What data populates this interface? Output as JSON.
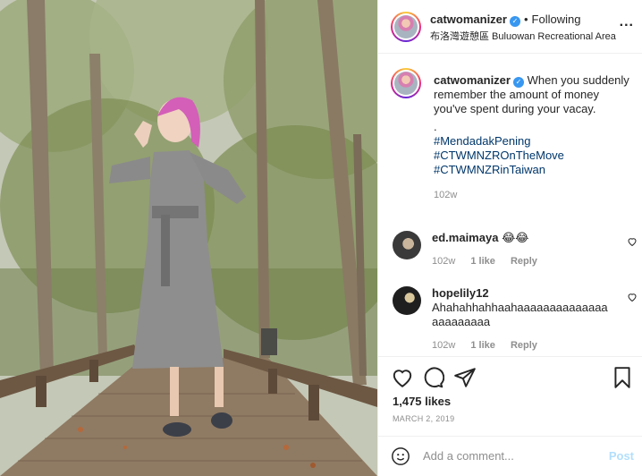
{
  "post": {
    "author": "catwomanizer",
    "verified": true,
    "follow_status": "Following",
    "location": "布洛灣遊憩區 Buluowan Recreational Area",
    "more_label": "...",
    "caption": "When you suddenly remember the amount of money you've spent during your vacay.",
    "caption_dot": ".",
    "hashtags": [
      "#MendadakPening",
      "#CTWMNZROnTheMove",
      "#CTWMNZRinTaiwan"
    ],
    "caption_age": "102w",
    "likes": "1,475 likes",
    "date": "MARCH 2, 2019"
  },
  "comments": [
    {
      "user": "ed.maimaya",
      "text": "😂😂",
      "age": "102w",
      "likes": "1 like",
      "reply_label": "Reply"
    },
    {
      "user": "hopelily12",
      "text": "Ahahahhahhaahaaaaaaaaaaaaaaaaaaaaaaa",
      "age": "102w",
      "likes": "1 like",
      "reply_label": "Reply"
    }
  ],
  "add_comment": {
    "placeholder": "Add a comment...",
    "post_label": "Post"
  },
  "icons": {
    "like": "heart-icon",
    "comment": "comment-icon",
    "share": "paper-plane-icon",
    "save": "bookmark-icon",
    "emoji": "smiley-icon",
    "more": "more-options-icon"
  },
  "colors": {
    "text": "#262626",
    "muted": "#8e8e8e",
    "hashtag": "#00376b",
    "verified": "#3897f0",
    "post_button_disabled": "#b2dffc"
  }
}
